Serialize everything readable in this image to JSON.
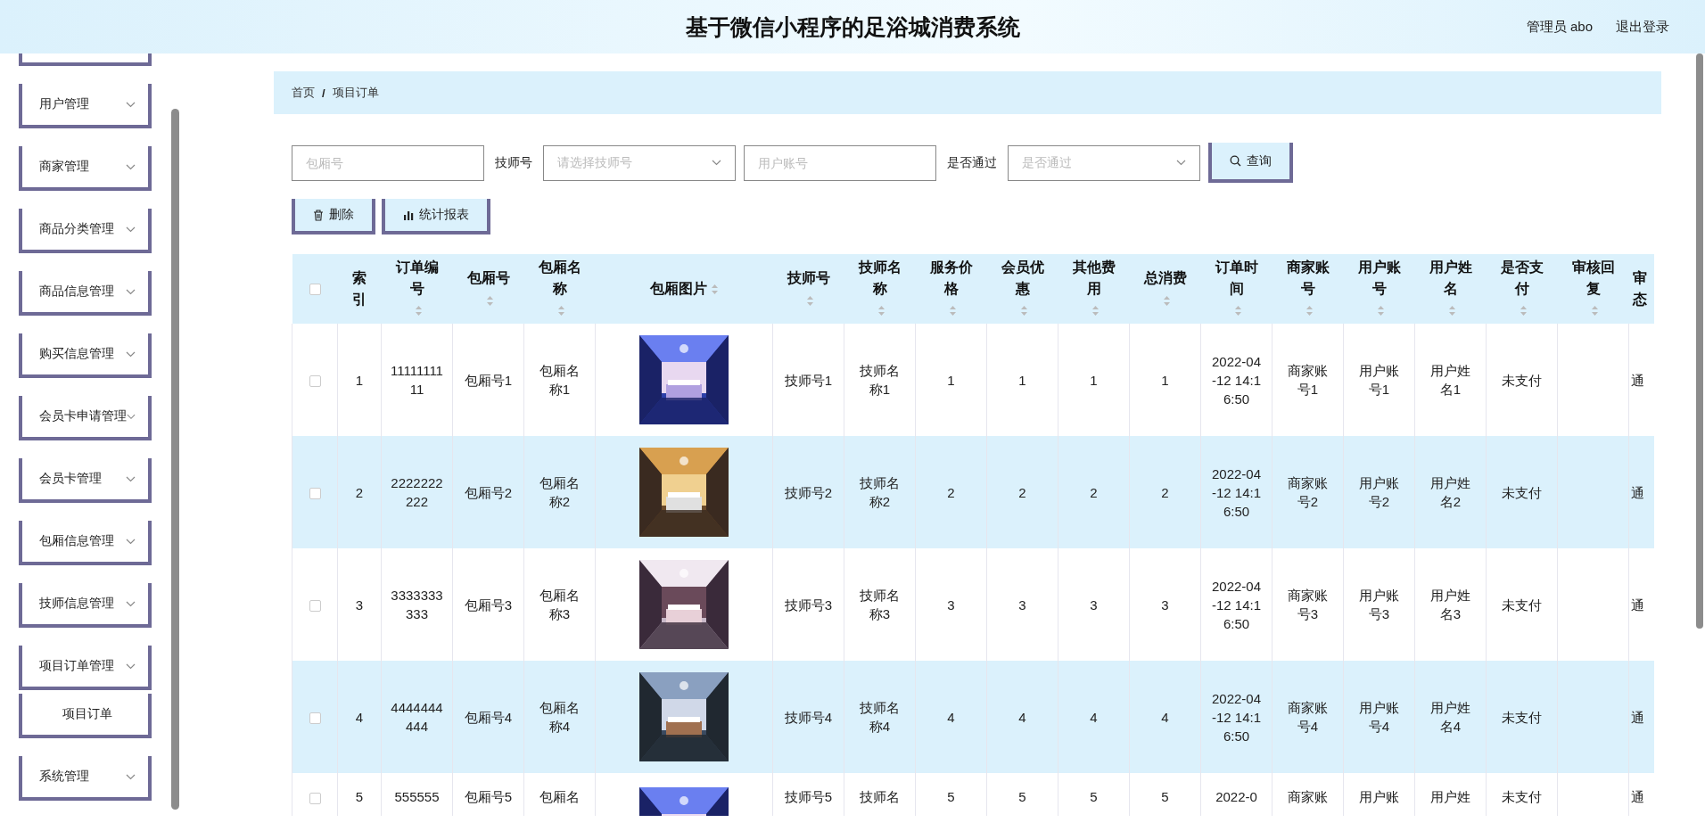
{
  "header": {
    "title": "基于微信小程序的足浴城消费系统",
    "user": "管理员 abo",
    "logout": "退出登录"
  },
  "sidebar": {
    "items": [
      {
        "label": "用户管理"
      },
      {
        "label": "商家管理"
      },
      {
        "label": "商品分类管理"
      },
      {
        "label": "商品信息管理"
      },
      {
        "label": "购买信息管理"
      },
      {
        "label": "会员卡申请管理"
      },
      {
        "label": "会员卡管理"
      },
      {
        "label": "包厢信息管理"
      },
      {
        "label": "技师信息管理"
      },
      {
        "label": "项目订单管理",
        "children": [
          {
            "label": "项目订单"
          }
        ]
      },
      {
        "label": "系统管理"
      }
    ]
  },
  "breadcrumb": {
    "separator": "/",
    "items": [
      "首页",
      "项目订单"
    ]
  },
  "search": [
    {
      "kind": "input",
      "placeholder": "包厢号"
    },
    {
      "kind": "select",
      "label": "技师号",
      "placeholder": "请选择技师号"
    },
    {
      "kind": "input",
      "placeholder": "用户账号"
    },
    {
      "kind": "select",
      "label": "是否通过",
      "placeholder": "是否通过"
    }
  ],
  "query_button": "查询",
  "actions": [
    {
      "kind": "delete",
      "label": "删除"
    },
    {
      "kind": "report",
      "label": "统计报表"
    }
  ],
  "table": {
    "select_all": {
      "checked": false
    },
    "columns": [
      {
        "label": "索引",
        "sortable": false
      },
      {
        "label": "订单编号",
        "sortable": true
      },
      {
        "label": "包厢号",
        "sortable": true
      },
      {
        "label": "包厢名称",
        "sortable": true
      },
      {
        "label": "包厢图片",
        "sortable": true
      },
      {
        "label": "技师号",
        "sortable": true
      },
      {
        "label": "技师名称",
        "sortable": true
      },
      {
        "label": "服务价格",
        "sortable": true
      },
      {
        "label": "会员优惠",
        "sortable": true
      },
      {
        "label": "其他费用",
        "sortable": true
      },
      {
        "label": "总消费",
        "sortable": true
      },
      {
        "label": "订单时间",
        "sortable": true
      },
      {
        "label": "商家账号",
        "sortable": true
      },
      {
        "label": "用户账号",
        "sortable": true
      },
      {
        "label": "用户姓名",
        "sortable": true
      },
      {
        "label": "是否支付",
        "sortable": true
      },
      {
        "label": "审核回复",
        "sortable": true
      },
      {
        "label": "审态",
        "sortable": false
      }
    ],
    "rows": [
      {
        "checked": false,
        "cells": [
          "1",
          "1111111111",
          "包厢号1",
          "包厢名称1",
          {
            "kind": "picture"
          },
          "技师号1",
          "技师名称1",
          "1",
          "1",
          "1",
          "1",
          "2022-04-12 14:16:50",
          "商家账号1",
          "用户账号1",
          "用户姓名1",
          "未支付",
          "",
          "通"
        ]
      },
      {
        "checked": false,
        "cells": [
          "2",
          "2222222222",
          "包厢号2",
          "包厢名称2",
          {
            "kind": "picture"
          },
          "技师号2",
          "技师名称2",
          "2",
          "2",
          "2",
          "2",
          "2022-04-12 14:16:50",
          "商家账号2",
          "用户账号2",
          "用户姓名2",
          "未支付",
          "",
          "通"
        ]
      },
      {
        "checked": false,
        "cells": [
          "3",
          "3333333333",
          "包厢号3",
          "包厢名称3",
          {
            "kind": "picture"
          },
          "技师号3",
          "技师名称3",
          "3",
          "3",
          "3",
          "3",
          "2022-04-12 14:16:50",
          "商家账号3",
          "用户账号3",
          "用户姓名3",
          "未支付",
          "",
          "通"
        ]
      },
      {
        "checked": false,
        "cells": [
          "4",
          "4444444444",
          "包厢号4",
          "包厢名称4",
          {
            "kind": "picture"
          },
          "技师号4",
          "技师名称4",
          "4",
          "4",
          "4",
          "4",
          "2022-04-12 14:16:50",
          "商家账号4",
          "用户账号4",
          "用户姓名4",
          "未支付",
          "",
          "通"
        ]
      },
      {
        "checked": false,
        "cells": [
          "5",
          "555555",
          "包厢号5",
          "包厢名",
          {
            "kind": "picture"
          },
          "技师号5",
          "技师名",
          "5",
          "5",
          "5",
          "5",
          "2022-0",
          "商家账",
          "用户账",
          "用户姓",
          "未支付",
          "",
          "通"
        ]
      }
    ]
  }
}
